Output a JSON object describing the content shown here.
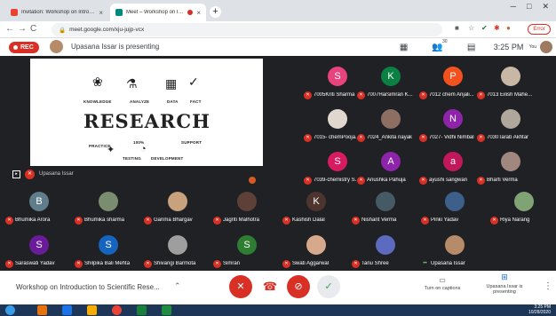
{
  "browser": {
    "tabs": [
      {
        "title": "Invitation: Workshop on Introd...",
        "close": "×"
      },
      {
        "title": "Meet – Workshop on Introd...",
        "close": "×"
      }
    ],
    "new_tab": "+",
    "url": "meet.google.com/xju-jujp-vcx",
    "error_label": "Error",
    "nav": {
      "back": "←",
      "forward": "→",
      "reload": "C",
      "home": "⌂"
    }
  },
  "meet": {
    "rec_label": "REC",
    "presenting_text": "Upasana Issar is presenting",
    "time": "3:25 PM",
    "you_label": "You",
    "people_count": "30",
    "slide": {
      "title": "RESEARCH",
      "labels": [
        "KNOWLEDGE",
        "ANALYZE",
        "DATA",
        "FACT",
        "PRACTICE",
        "100%",
        "TESTING",
        "DEVELOPMENT",
        "SUPPORT"
      ]
    },
    "presenter_tile_name": "Upasana Issar",
    "participants": [
      {
        "name": "7005Kriti Sharma",
        "initial": "S",
        "color": "#e8437c"
      },
      {
        "name": "7007Harsimran K...",
        "initial": "K",
        "color": "#0b8043"
      },
      {
        "name": "7012 chem Anjali...",
        "initial": "P",
        "color": "#f4511e"
      },
      {
        "name": "7013 Eilish Mahe...",
        "initial": "",
        "color": "#c9b7a6"
      },
      {
        "name": "7015- chemPooja...",
        "initial": "",
        "color": "#e0d8cf"
      },
      {
        "name": "7024_Ankita nayak",
        "initial": "",
        "color": "#8d6e63"
      },
      {
        "name": "7027- Vidhi Nimbal",
        "initial": "N",
        "color": "#8e24aa"
      },
      {
        "name": "7030Tarab Akhtar",
        "initial": "",
        "color": "#b0a79c"
      },
      {
        "name": "7039-chemistry S...",
        "initial": "S",
        "color": "#d81b60"
      },
      {
        "name": "Anushka Pahuja",
        "initial": "A",
        "color": "#8e24aa"
      },
      {
        "name": "ayushi sangwan",
        "initial": "a",
        "color": "#c2185b"
      },
      {
        "name": "Bharti Verma",
        "initial": "",
        "color": "#a1887f"
      },
      {
        "name": "Bhumika Arora",
        "initial": "B",
        "color": "#607d8b"
      },
      {
        "name": "Bhumika sharma",
        "initial": "",
        "color": "#7b8d6f"
      },
      {
        "name": "Garima Bhargav",
        "initial": "",
        "color": "#c8a27c"
      },
      {
        "name": "Jagriti Malhotra",
        "initial": "",
        "color": "#5d4037"
      },
      {
        "name": "Kashish Dalal",
        "initial": "K",
        "color": "#4e342e"
      },
      {
        "name": "Nishant Verma",
        "initial": "",
        "color": "#455a64"
      },
      {
        "name": "Pinki Yadav",
        "initial": "",
        "color": "#3e5f8a"
      },
      {
        "name": "Riya Narang",
        "initial": "",
        "color": "#7fa374"
      },
      {
        "name": "Saraswati Yadav",
        "initial": "S",
        "color": "#6a1b9a"
      },
      {
        "name": "Shilpika Bali Mehta",
        "initial": "S",
        "color": "#1565c0"
      },
      {
        "name": "Shivangi Barmota",
        "initial": "",
        "color": "#9e9e9e"
      },
      {
        "name": "Simran",
        "initial": "S",
        "color": "#2e7d32"
      },
      {
        "name": "Swati Aggarwal",
        "initial": "",
        "color": "#d7a98c"
      },
      {
        "name": "Tanu Shree",
        "initial": "",
        "color": "#5c6bc0"
      },
      {
        "name": "Upasana Issar",
        "initial": "",
        "color": "#b58b6a",
        "speaking": true
      }
    ]
  },
  "bottom": {
    "meeting_title": "Workshop on Introduction to Scientific Rese...",
    "captions_label": "Turn on captions",
    "presenting_label": "Upasana Issar is presenting"
  },
  "taskbar": {
    "time": "3:25 PM",
    "date": "10/28/2020"
  },
  "colors": {
    "rec": "#d93025",
    "meet_bg": "#202124",
    "accent": "#1a73e8"
  }
}
